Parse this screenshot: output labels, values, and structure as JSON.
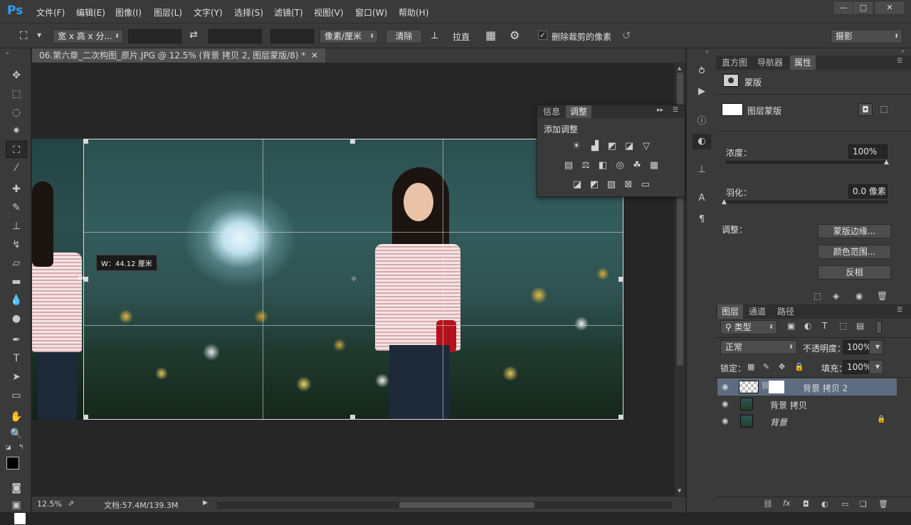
{
  "app": {
    "logo": "Ps",
    "accent": "#2da0f0"
  },
  "menu": [
    "文件(F)",
    "编辑(E)",
    "图像(I)",
    "图层(L)",
    "文字(Y)",
    "选择(S)",
    "滤镜(T)",
    "视图(V)",
    "窗口(W)",
    "帮助(H)"
  ],
  "window_controls": {
    "minimize": "—",
    "restore": "□",
    "close": "✕"
  },
  "options": {
    "ratio_dropdown": "宽 x 高 x 分...",
    "width_value": "",
    "height_value": "",
    "resolution_value": "",
    "unit_dropdown": "像素/厘米",
    "clear_button": "清除",
    "straighten_label": "拉直",
    "delete_cropped_label": "删除裁剪的像素",
    "delete_cropped_checked": true,
    "workspace_dropdown": "摄影"
  },
  "document": {
    "tab_title": "06.第六章_二次构图_原片.JPG @ 12.5% (背景 拷贝 2, 图层蒙版/8) *",
    "crop_tooltip": "W：44.12 厘米"
  },
  "status": {
    "zoom": "12.5%",
    "doc_size": "文档:57.4M/139.3M"
  },
  "adjust_panel": {
    "tabs": [
      "信息",
      "调整"
    ],
    "active_tab": "调整",
    "heading": "添加调整"
  },
  "properties_panel": {
    "tabs": [
      "直方图",
      "导航器",
      "属性"
    ],
    "active_tab": "属性",
    "mask_title": "蒙版",
    "layer_mask_label": "图层蒙版",
    "density_label": "浓度：",
    "density_value": "100%",
    "feather_label": "羽化：",
    "feather_value": "0.0 像素",
    "adjust_label": "调整：",
    "mask_edge_button": "蒙版边缘...",
    "color_range_button": "颜色范围...",
    "invert_button": "反相"
  },
  "layers_panel": {
    "tabs": [
      "图层",
      "通道",
      "路径"
    ],
    "active_tab": "图层",
    "filter_dropdown": "类型",
    "blend_mode": "正常",
    "opacity_label": "不透明度：",
    "opacity_value": "100%",
    "lock_label": "锁定：",
    "fill_label": "填充：",
    "fill_value": "100%",
    "layers": [
      {
        "name": "背景 拷贝 2",
        "selected": true
      },
      {
        "name": "背景 拷贝",
        "selected": false
      },
      {
        "name": "背景",
        "selected": false
      }
    ]
  }
}
